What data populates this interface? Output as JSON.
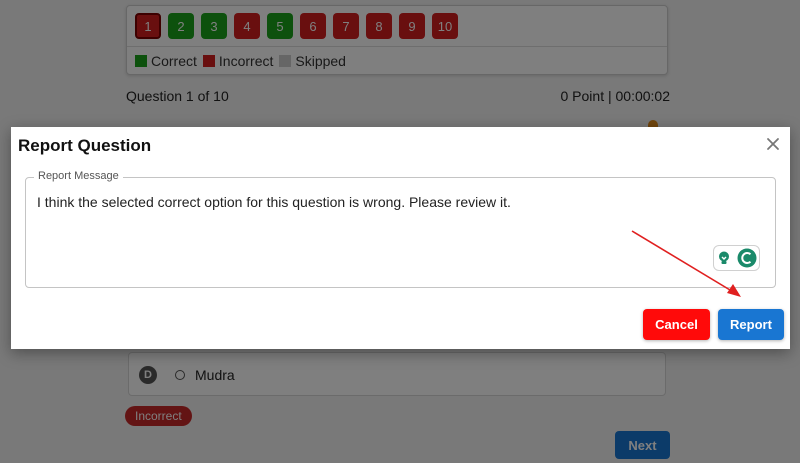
{
  "question_nav": {
    "buttons": [
      {
        "label": "1",
        "status": "incorrect"
      },
      {
        "label": "2",
        "status": "correct"
      },
      {
        "label": "3",
        "status": "correct"
      },
      {
        "label": "4",
        "status": "incorrect"
      },
      {
        "label": "5",
        "status": "correct"
      },
      {
        "label": "6",
        "status": "incorrect"
      },
      {
        "label": "7",
        "status": "incorrect"
      },
      {
        "label": "8",
        "status": "incorrect"
      },
      {
        "label": "9",
        "status": "incorrect"
      },
      {
        "label": "10",
        "status": "incorrect"
      }
    ],
    "legend": {
      "correct": "Correct",
      "incorrect": "Incorrect",
      "skipped": "Skipped"
    }
  },
  "question_info": {
    "position": "Question 1 of 10",
    "score_time": "0 Point | 00:00:02"
  },
  "option_d": {
    "letter": "D",
    "text": "Mudra"
  },
  "result_badge": "Incorrect",
  "next_label": "Next",
  "modal": {
    "title": "Report Question",
    "field_label": "Report Message",
    "message": "I think the selected correct option for this question is wrong. Please review it.",
    "cancel_label": "Cancel",
    "report_label": "Report"
  },
  "colors": {
    "correct": "#1aa31a",
    "incorrect": "#d21f1f",
    "skipped": "#cccccc",
    "primary": "#1976d2",
    "cancel": "#ff0a0a",
    "annotation_arrow": "#e02020",
    "assistant_green": "#1a8a6a"
  },
  "icons": {
    "close": "close-icon",
    "assistant_bulb": "lightbulb-icon",
    "assistant_logo": "grammar-assistant-icon"
  }
}
